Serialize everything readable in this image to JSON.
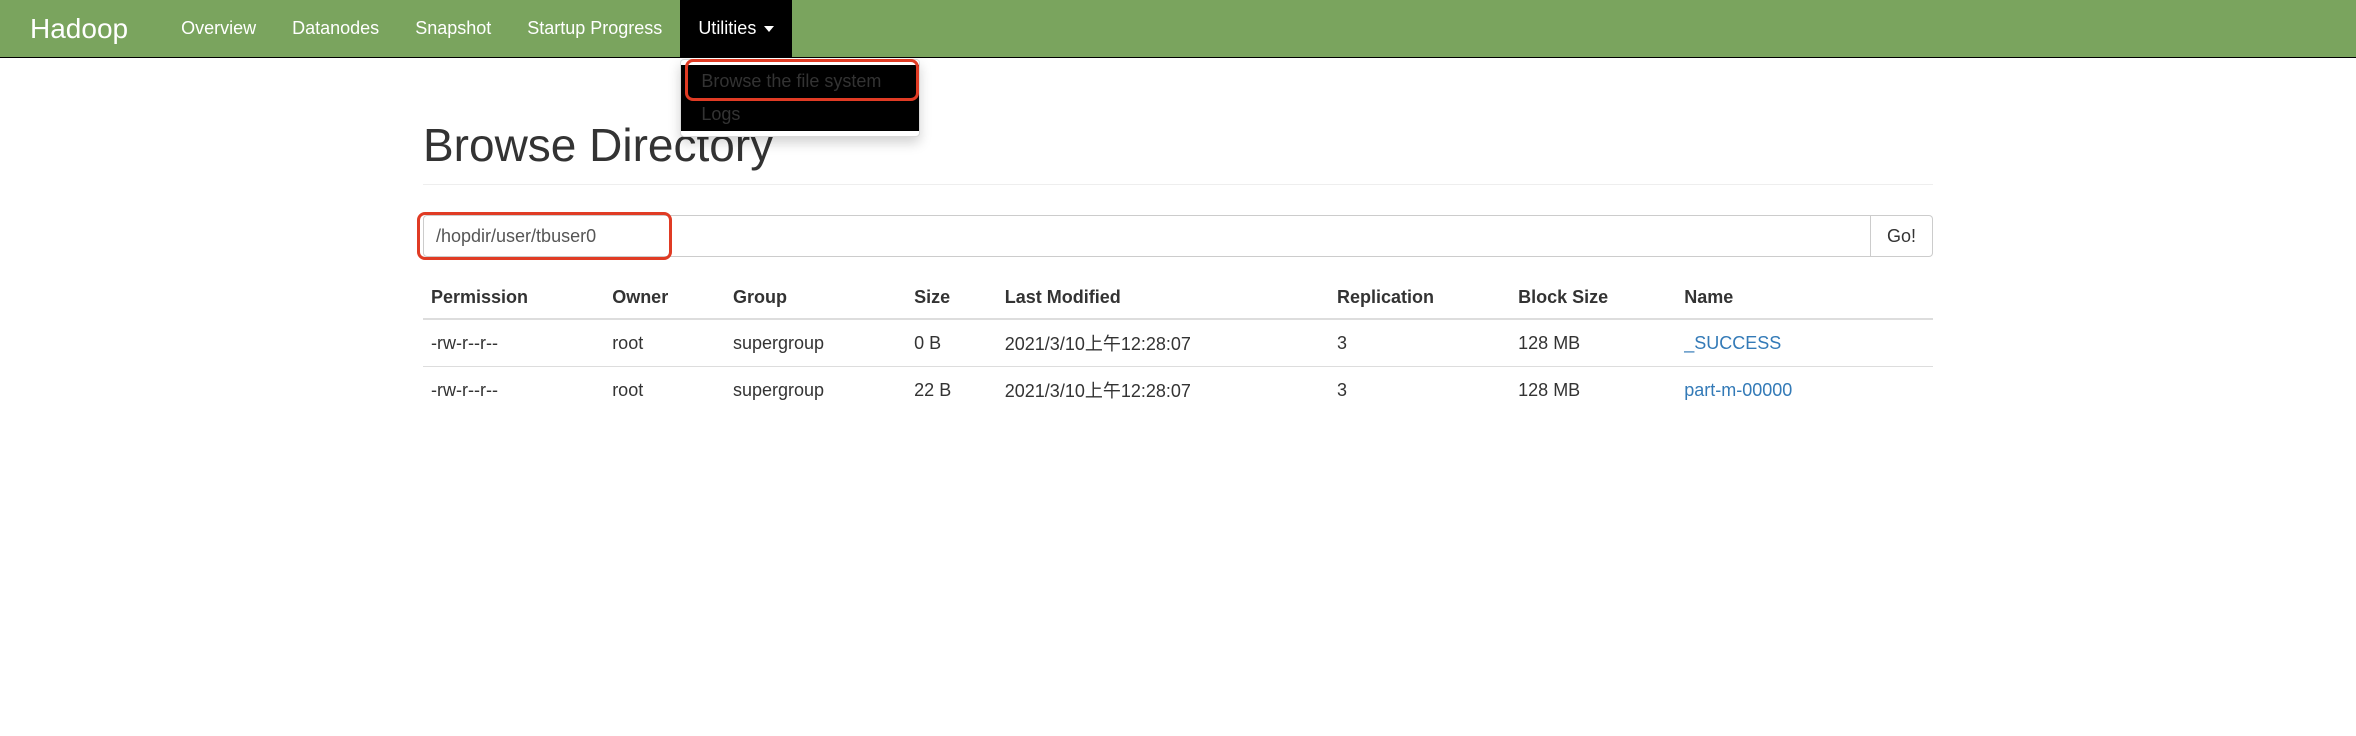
{
  "navbar": {
    "brand": "Hadoop",
    "items": [
      {
        "label": "Overview"
      },
      {
        "label": "Datanodes"
      },
      {
        "label": "Snapshot"
      },
      {
        "label": "Startup Progress"
      },
      {
        "label": "Utilities",
        "active": true
      }
    ],
    "dropdown": [
      {
        "label": "Browse the file system"
      },
      {
        "label": "Logs"
      }
    ]
  },
  "page": {
    "title": "Browse Directory"
  },
  "path_input": {
    "value": "/hopdir/user/tbuser0",
    "go_label": "Go!"
  },
  "table": {
    "headers": {
      "permission": "Permission",
      "owner": "Owner",
      "group": "Group",
      "size": "Size",
      "modified": "Last Modified",
      "replication": "Replication",
      "blocksize": "Block Size",
      "name": "Name"
    },
    "rows": [
      {
        "permission": "-rw-r--r--",
        "owner": "root",
        "group": "supergroup",
        "size": "0 B",
        "modified": "2021/3/10上午12:28:07",
        "replication": "3",
        "blocksize": "128 MB",
        "name": "_SUCCESS"
      },
      {
        "permission": "-rw-r--r--",
        "owner": "root",
        "group": "supergroup",
        "size": "22 B",
        "modified": "2021/3/10上午12:28:07",
        "replication": "3",
        "blocksize": "128 MB",
        "name": "part-m-00000"
      }
    ]
  }
}
